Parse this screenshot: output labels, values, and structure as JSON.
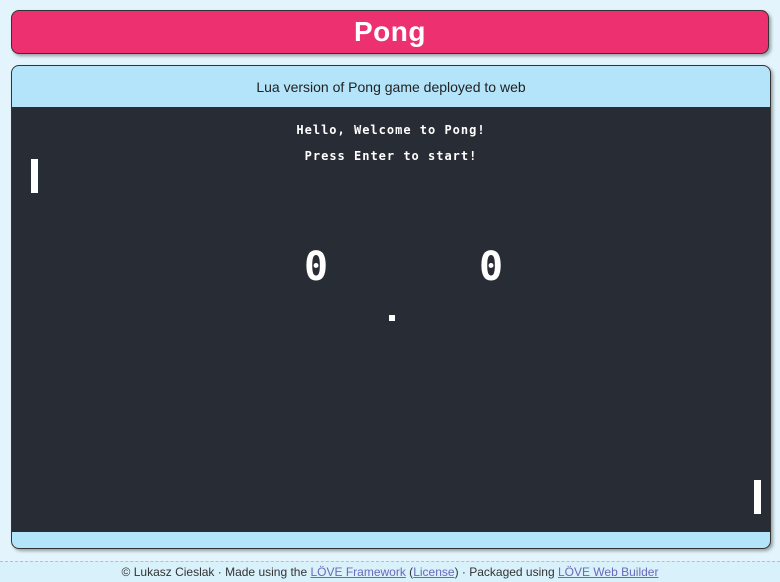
{
  "header": {
    "title": "Pong",
    "bg_color": "#ed3070"
  },
  "panel": {
    "subtitle": "Lua version of Pong game deployed to web",
    "bg_color": "#b3e4fa"
  },
  "game": {
    "background_color": "#282c34",
    "welcome_text": "Hello, Welcome to Pong!",
    "prompt_text": "Press Enter to start!",
    "player1_score": "0",
    "player2_score": "0"
  },
  "footer": {
    "copyright": "© Lukasz Cieslak · Made using the ",
    "love_link": "LÖVE Framework",
    "open_paren": " (",
    "license_link": "License",
    "close_paren": ") · Packaged using ",
    "builder_link": "LÖVE Web Builder"
  }
}
